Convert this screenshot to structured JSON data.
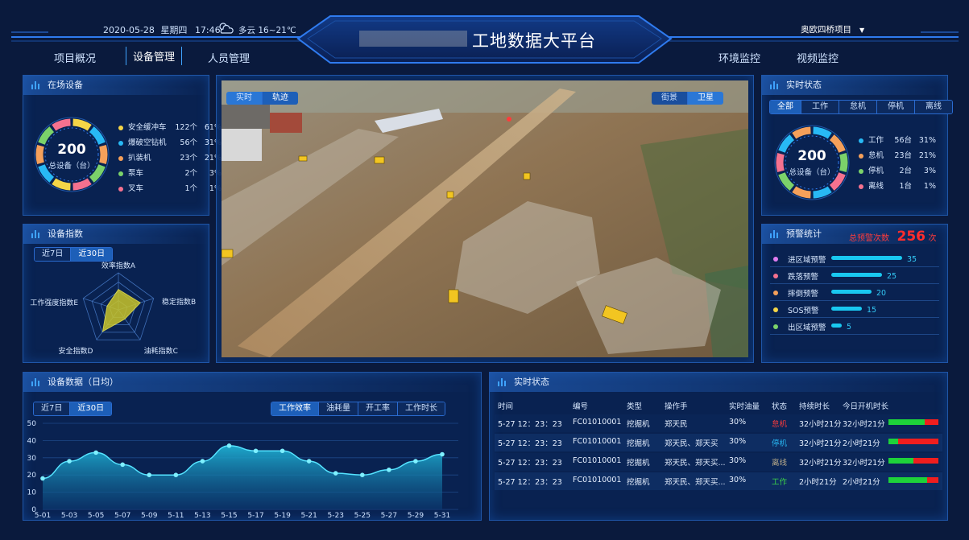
{
  "header": {
    "date": "2020-05-28",
    "weekday": "星期四",
    "time": "17:46",
    "weather": "多云 16~21℃",
    "title": "工地数据大平台",
    "project": "奥欧四桥项目"
  },
  "nav": {
    "left": [
      "项目概况",
      "设备管理",
      "人员管理"
    ],
    "right": [
      "环境监控",
      "视频监控"
    ],
    "active": 1
  },
  "onsite": {
    "title": "在场设备",
    "total": "200",
    "total_label": "总设备（台）",
    "items": [
      {
        "name": "安全缓冲车",
        "count": "122个",
        "pct": "61%",
        "color": "#f5d547",
        "value": 122
      },
      {
        "name": "爆破空钻机",
        "count": "56个",
        "pct": "31%",
        "color": "#28b9f5",
        "value": 56
      },
      {
        "name": "扒装机",
        "count": "23个",
        "pct": "21%",
        "color": "#f5a05a",
        "value": 23
      },
      {
        "name": "泵车",
        "count": "2个",
        "pct": "3%",
        "color": "#7bd26a",
        "value": 2
      },
      {
        "name": "叉车",
        "count": "1个",
        "pct": "1%",
        "color": "#f5718f",
        "value": 1
      }
    ]
  },
  "index": {
    "title": "设备指数",
    "tabs": [
      "近7日",
      "近30日"
    ],
    "active": 1,
    "axes": [
      "效率指数A",
      "稳定指数B",
      "油耗指数C",
      "安全指数D",
      "工作强度指数E"
    ],
    "values": [
      0.55,
      0.62,
      0.3,
      0.72,
      0.32
    ]
  },
  "video": {
    "tabs_left": [
      "实时",
      "轨迹"
    ],
    "tabs_right": [
      "街景",
      "卫星"
    ],
    "active_left": 1,
    "active_right": 1
  },
  "status": {
    "title": "实时状态",
    "tabs": [
      "全部",
      "工作",
      "怠机",
      "停机",
      "离线"
    ],
    "active": 0,
    "total": "200",
    "total_label": "总设备（台）",
    "items": [
      {
        "name": "工作",
        "count": "56台",
        "pct": "31%",
        "color": "#28b9f5",
        "value": 56
      },
      {
        "name": "怠机",
        "count": "23台",
        "pct": "21%",
        "color": "#f5a05a",
        "value": 23
      },
      {
        "name": "停机",
        "count": "2台",
        "pct": "3%",
        "color": "#7bd26a",
        "value": 2
      },
      {
        "name": "离线",
        "count": "1台",
        "pct": "1%",
        "color": "#f5718f",
        "value": 1
      }
    ]
  },
  "alerts": {
    "title": "预警统计",
    "total_label": "总预警次数",
    "total": "256",
    "unit": "次",
    "items": [
      {
        "name": "进区域预警",
        "value": 35,
        "color": "#e07cf0"
      },
      {
        "name": "跌落预警",
        "value": 25,
        "color": "#f5718f"
      },
      {
        "name": "摔倒预警",
        "value": 20,
        "color": "#f5a05a"
      },
      {
        "name": "SOS预警",
        "value": 15,
        "color": "#f5d547"
      },
      {
        "name": "出区域预警",
        "value": 5,
        "color": "#7bd26a"
      }
    ]
  },
  "device_data": {
    "title": "设备数据（日均）",
    "tabs": [
      "近7日",
      "近30日"
    ],
    "active": 1,
    "metrics": [
      "工作效率",
      "油耗量",
      "开工率",
      "工作时长"
    ],
    "active_metric": 0
  },
  "chart_data": {
    "type": "area",
    "x": [
      "5-01",
      "5-03",
      "5-05",
      "5-07",
      "5-09",
      "5-11",
      "5-13",
      "5-15",
      "5-17",
      "5-19",
      "5-21",
      "5-23",
      "5-25",
      "5-27",
      "5-29",
      "5-31"
    ],
    "values": [
      18,
      28,
      33,
      26,
      20,
      20,
      28,
      37,
      34,
      34,
      28,
      21,
      20,
      23,
      28,
      32
    ],
    "ylim": [
      0,
      50
    ],
    "yticks": [
      0,
      10,
      20,
      30,
      40,
      50
    ]
  },
  "realtime": {
    "title": "实时状态",
    "columns": [
      "时间",
      "编号",
      "类型",
      "操作手",
      "实时油量",
      "状态",
      "持续时长",
      "今日开机时长"
    ],
    "rows": [
      {
        "time": "5-27  12：23：23",
        "id": "FC01010001",
        "type": "挖掘机",
        "operator": "郑天民",
        "fuel": "30%",
        "status": "怠机",
        "status_color": "#ff3b3b",
        "duration": "32小时21分",
        "today": "32小时21分",
        "green": 0.72,
        "red": 0.28
      },
      {
        "time": "5-27  12：23：23",
        "id": "FC01010001",
        "type": "挖掘机",
        "operator": "郑天民、郑天买",
        "fuel": "30%",
        "status": "停机",
        "status_color": "#28b9f5",
        "duration": "32小时21分",
        "today": "2小时21分",
        "green": 0.2,
        "red": 0.8
      },
      {
        "time": "5-27  12：23：23",
        "id": "FC01010001",
        "type": "挖掘机",
        "operator": "郑天民、郑天买...",
        "fuel": "30%",
        "status": "离线",
        "status_color": "#b7a98a",
        "duration": "32小时21分",
        "today": "32小时21分",
        "green": 0.5,
        "red": 0.5
      },
      {
        "time": "5-27  12：23：23",
        "id": "FC01010001",
        "type": "挖掘机",
        "operator": "郑天民、郑天买...",
        "fuel": "30%",
        "status": "工作",
        "status_color": "#3bd14a",
        "duration": "2小时21分",
        "today": "2小时21分",
        "green": 0.78,
        "red": 0.22
      }
    ]
  }
}
